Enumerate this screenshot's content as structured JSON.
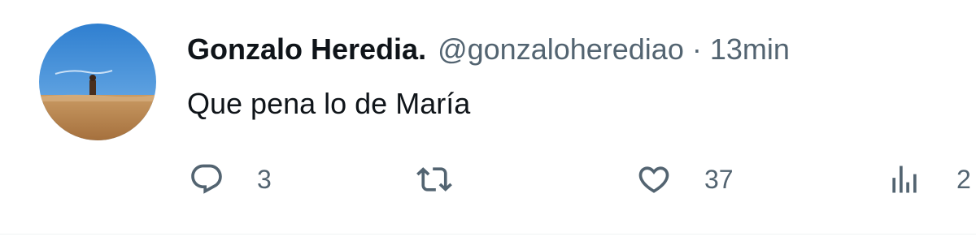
{
  "tweet": {
    "author_name": "Gonzalo Heredia.",
    "handle": "@gonzaloherediao",
    "separator": "·",
    "timestamp": "13min",
    "text": "Que pena lo de María",
    "actions": {
      "reply_count": "3",
      "retweet_count": "",
      "like_count": "37",
      "views_count": "2"
    }
  },
  "icons": {
    "reply": "speech-bubble-icon",
    "retweet": "retweet-arrows-icon",
    "like": "heart-outline-icon",
    "views": "bar-chart-icon"
  },
  "colors": {
    "text_primary": "#0f1419",
    "text_secondary": "#536471",
    "avatar_sky": "#3f8fd8",
    "avatar_sand": "#b8804a"
  }
}
